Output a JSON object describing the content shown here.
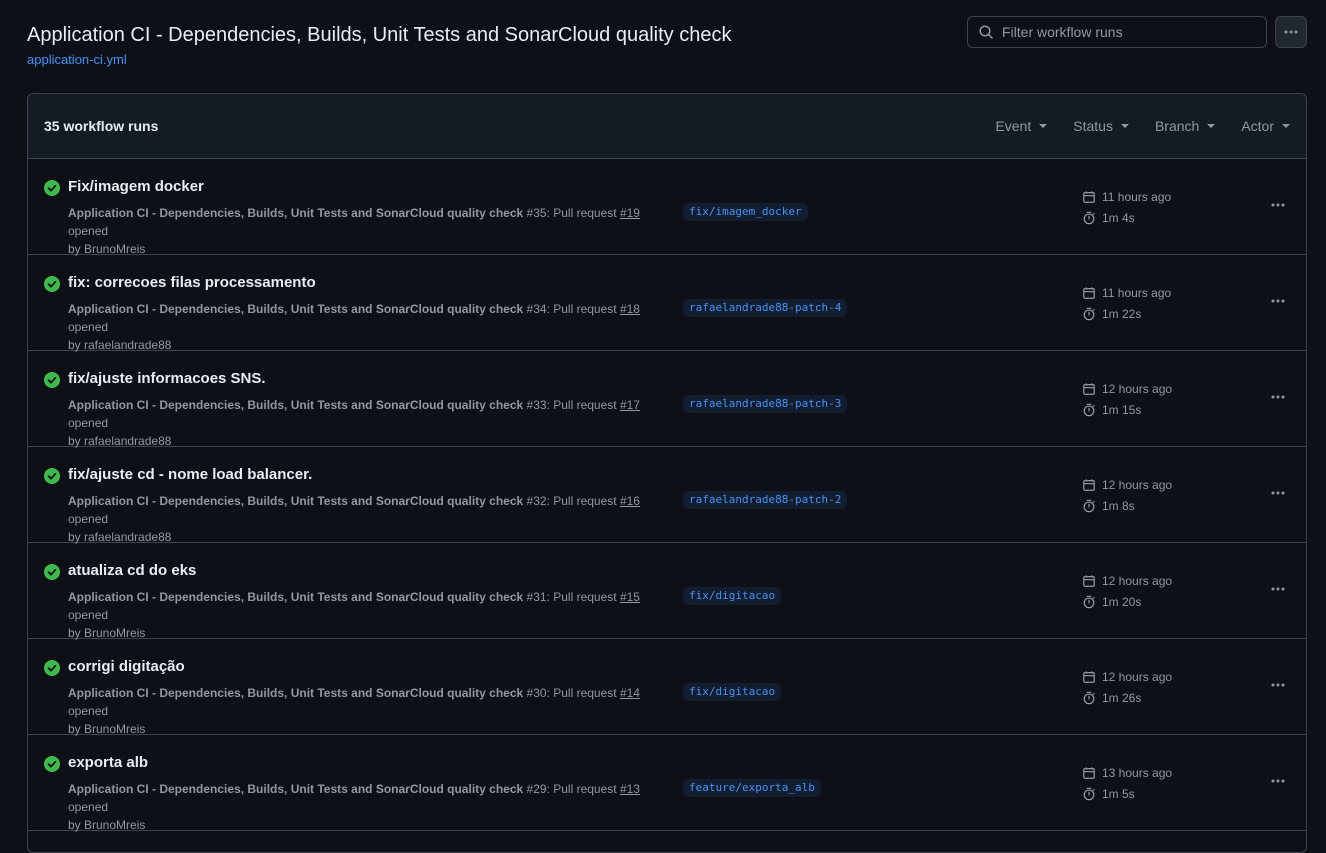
{
  "header": {
    "title": "Application CI - Dependencies, Builds, Unit Tests and SonarCloud quality check",
    "workflow_file": "application-ci.yml"
  },
  "search": {
    "placeholder": "Filter workflow runs",
    "value": ""
  },
  "list": {
    "count_label": "35 workflow runs",
    "filters": [
      "Event",
      "Status",
      "Branch",
      "Actor"
    ]
  },
  "runs": [
    {
      "title": "Fix/imagem docker",
      "workflow": "Application CI - Dependencies, Builds, Unit Tests and SonarCloud quality check",
      "run_number": "#35",
      "event_text": ": Pull request ",
      "pr": "#19",
      "action": " opened",
      "by": "by BrunoMreis",
      "branch": "fix/imagem_docker",
      "when": "11 hours ago",
      "duration": "1m 4s",
      "status": "success"
    },
    {
      "title": "fix: correcoes filas processamento",
      "workflow": "Application CI - Dependencies, Builds, Unit Tests and SonarCloud quality check",
      "run_number": "#34",
      "event_text": ": Pull request ",
      "pr": "#18",
      "action": " opened",
      "by": "by rafaelandrade88",
      "branch": "rafaelandrade88-patch-4",
      "when": "11 hours ago",
      "duration": "1m 22s",
      "status": "success"
    },
    {
      "title": "fix/ajuste informacoes SNS.",
      "workflow": "Application CI - Dependencies, Builds, Unit Tests and SonarCloud quality check",
      "run_number": "#33",
      "event_text": ": Pull request ",
      "pr": "#17",
      "action": " opened",
      "by": "by rafaelandrade88",
      "branch": "rafaelandrade88-patch-3",
      "when": "12 hours ago",
      "duration": "1m 15s",
      "status": "success"
    },
    {
      "title": "fix/ajuste cd - nome load balancer.",
      "workflow": "Application CI - Dependencies, Builds, Unit Tests and SonarCloud quality check",
      "run_number": "#32",
      "event_text": ": Pull request ",
      "pr": "#16",
      "action": " opened",
      "by": "by rafaelandrade88",
      "branch": "rafaelandrade88-patch-2",
      "when": "12 hours ago",
      "duration": "1m 8s",
      "status": "success"
    },
    {
      "title": "atualiza cd do eks",
      "workflow": "Application CI - Dependencies, Builds, Unit Tests and SonarCloud quality check",
      "run_number": "#31",
      "event_text": ": Pull request ",
      "pr": "#15",
      "action": " opened",
      "by": "by BrunoMreis",
      "branch": "fix/digitacao",
      "when": "12 hours ago",
      "duration": "1m 20s",
      "status": "success"
    },
    {
      "title": "corrigi digitação",
      "workflow": "Application CI - Dependencies, Builds, Unit Tests and SonarCloud quality check",
      "run_number": "#30",
      "event_text": ": Pull request ",
      "pr": "#14",
      "action": " opened",
      "by": "by BrunoMreis",
      "branch": "fix/digitacao",
      "when": "12 hours ago",
      "duration": "1m 26s",
      "status": "success"
    },
    {
      "title": "exporta alb",
      "workflow": "Application CI - Dependencies, Builds, Unit Tests and SonarCloud quality check",
      "run_number": "#29",
      "event_text": ": Pull request ",
      "pr": "#13",
      "action": " opened",
      "by": "by BrunoMreis",
      "branch": "feature/exporta_alb",
      "when": "13 hours ago",
      "duration": "1m 5s",
      "status": "success"
    }
  ],
  "colors": {
    "success": "#3fb950",
    "accent": "#4493f8",
    "muted": "#9198a1",
    "border": "#3d444d"
  },
  "icons": {
    "status": "check-circle-fill-icon",
    "date": "calendar-icon",
    "duration": "stopwatch-icon",
    "more": "kebab-horizontal-icon",
    "search": "search-icon",
    "filter_caret": "triangle-down-icon"
  }
}
